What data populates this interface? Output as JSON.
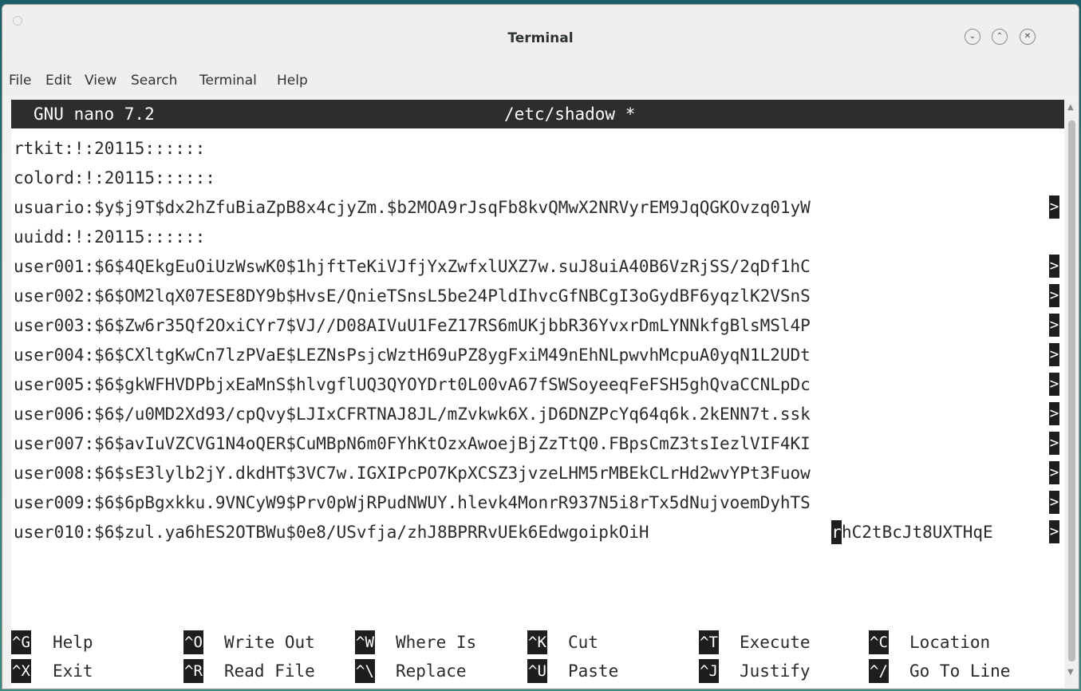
{
  "window": {
    "title": "Terminal",
    "controls": {
      "minimize_icon": "chevron-down-icon",
      "maximize_icon": "chevron-up-icon",
      "close_icon": "close-icon"
    }
  },
  "menubar": {
    "items": [
      "File",
      "Edit",
      "View",
      "Search",
      "Terminal",
      "Help"
    ]
  },
  "nano": {
    "version": "GNU nano 7.2",
    "filename": "/etc/shadow *"
  },
  "file_lines": [
    "rtkit:!:20115::::::",
    "colord:!:20115::::::",
    "usuario:$y$j9T$dx2hZfuBiaZpB8x4cjyZm.$b2MOA9rJsqFb8kvQMwX2NRVyrEM9JqQGKOvzq01yW",
    "uuidd:!:20115::::::",
    "user001:$6$4QEkgEuOiUzWswK0$1hjftTeKiVJfjYxZwfxlUXZ7w.suJ8uiA40B6VzRjSS/2qDf1hC",
    "user002:$6$OM2lqX07ESE8DY9b$HvsE/QnieTSnsL5be24PldIhvcGfNBCgI3oGydBF6yqzlK2VSnS",
    "user003:$6$Zw6r35Qf2OxiCYr7$VJ//D08AIVuU1FeZ17RS6mUKjbbR36YvxrDmLYNNkfgBlsMSl4P",
    "user004:$6$CXltgKwCn7lzPVaE$LEZNsPsjcWztH69uPZ8ygFxiM49nEhNLpwvhMcpuA0yqN1L2UDt",
    "user005:$6$gkWFHVDPbjxEaMnS$hlvgflUQ3QYOYDrt0L00vA67fSWSoyeeqFeFSH5ghQvaCCNLpDc",
    "user006:$6$/u0MD2Xd93/cpQvy$LJIxCFRTNAJ8JL/mZvkwk6X.jD6DNZPcYq64q6k.2kENN7t.ssk",
    "user007:$6$avIuVZCVG1N4oQER$CuMBpN6m0FYhKtOzxAwoejBjZzTtQ0.FBpsCmZ3tsIezlVIF4KI",
    "user008:$6$sE3lylb2jY.dkdHT$3VC7w.IGXIPcPO7KpXCSZ3jvzeLHM5rMBEkCLrHd2wvYPt3Fuow",
    "user009:$6$6pBgxkku.9VNCyW9$Prv0pWjRPudNWUY.hlevk4MonrR937N5i8rTx5dNujvoemDyhTS",
    "user010:$6$zul.ya6hES2OTBWu$0e8/USvfja/zhJ8BPRRvUEk6EdwgoipkOiH"
  ],
  "line10_after_cursor": "hC2tBcJt8UXTHqE",
  "cursor_char": "r",
  "continuation_marker": ">",
  "shortcuts": [
    {
      "key": "^G",
      "label": "Help"
    },
    {
      "key": "^O",
      "label": "Write Out"
    },
    {
      "key": "^W",
      "label": "Where Is"
    },
    {
      "key": "^K",
      "label": "Cut"
    },
    {
      "key": "^T",
      "label": "Execute"
    },
    {
      "key": "^C",
      "label": "Location"
    },
    {
      "key": "^X",
      "label": "Exit"
    },
    {
      "key": "^R",
      "label": "Read File"
    },
    {
      "key": "^\\",
      "label": "Replace"
    },
    {
      "key": "^U",
      "label": "Paste"
    },
    {
      "key": "^J",
      "label": "Justify"
    },
    {
      "key": "^/",
      "label": "Go To Line"
    }
  ],
  "scrollbar": {
    "up_icon": "arrow-up-icon",
    "down_icon": "arrow-down-icon"
  }
}
